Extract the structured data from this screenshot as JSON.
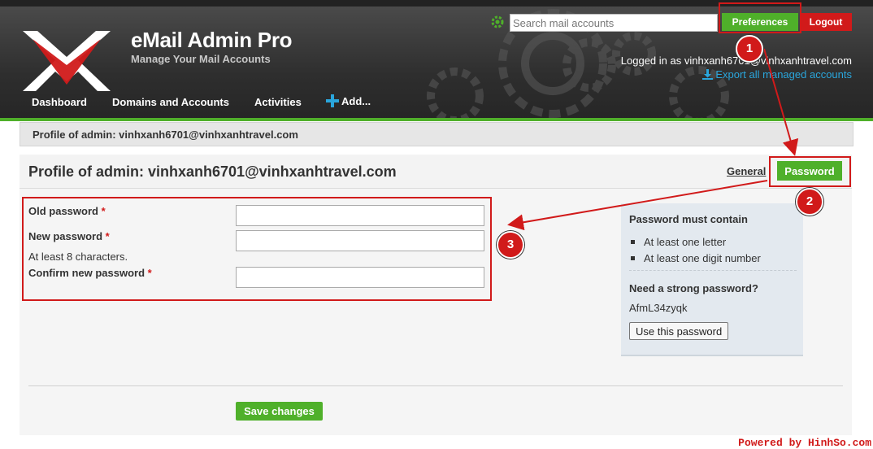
{
  "app": {
    "title": "eMail Admin Pro",
    "subtitle": "Manage Your Mail Accounts"
  },
  "header": {
    "search_placeholder": "Search mail accounts",
    "preferences_label": "Preferences",
    "logout_label": "Logout",
    "logged_in_text": "Logged in as vinhxanh6701@vinhxanhtravel.com",
    "export_label": "Export all managed accounts"
  },
  "nav": {
    "items": [
      {
        "label": "Dashboard"
      },
      {
        "label": "Domains and Accounts"
      },
      {
        "label": "Activities"
      },
      {
        "label": "Add..."
      }
    ]
  },
  "breadcrumb": "Profile of admin: vinhxanh6701@vinhxanhtravel.com",
  "main": {
    "title": "Profile of admin: vinhxanh6701@vinhxanhtravel.com",
    "tabs": [
      {
        "label": "General"
      },
      {
        "label": "Password"
      }
    ],
    "form": {
      "old_password_label": "Old password",
      "new_password_label": "New password",
      "new_password_hint": "At least 8 characters.",
      "confirm_password_label": "Confirm new password",
      "required_marker": "*",
      "save_label": "Save changes"
    },
    "sidebar": {
      "rules_title": "Password must contain",
      "rules": [
        "At least one letter",
        "At least one digit number"
      ],
      "strong_title": "Need a strong password?",
      "suggested_password": "AfmL34zyqk",
      "use_button_label": "Use this password"
    }
  },
  "annotations": {
    "badges": [
      "1",
      "2",
      "3"
    ],
    "color": "#d11a1a"
  },
  "colors": {
    "accent_green": "#4fb02a",
    "danger_red": "#d11a1a",
    "link_blue": "#2aa6dc"
  },
  "watermark": "Powered by HinhSo.com"
}
